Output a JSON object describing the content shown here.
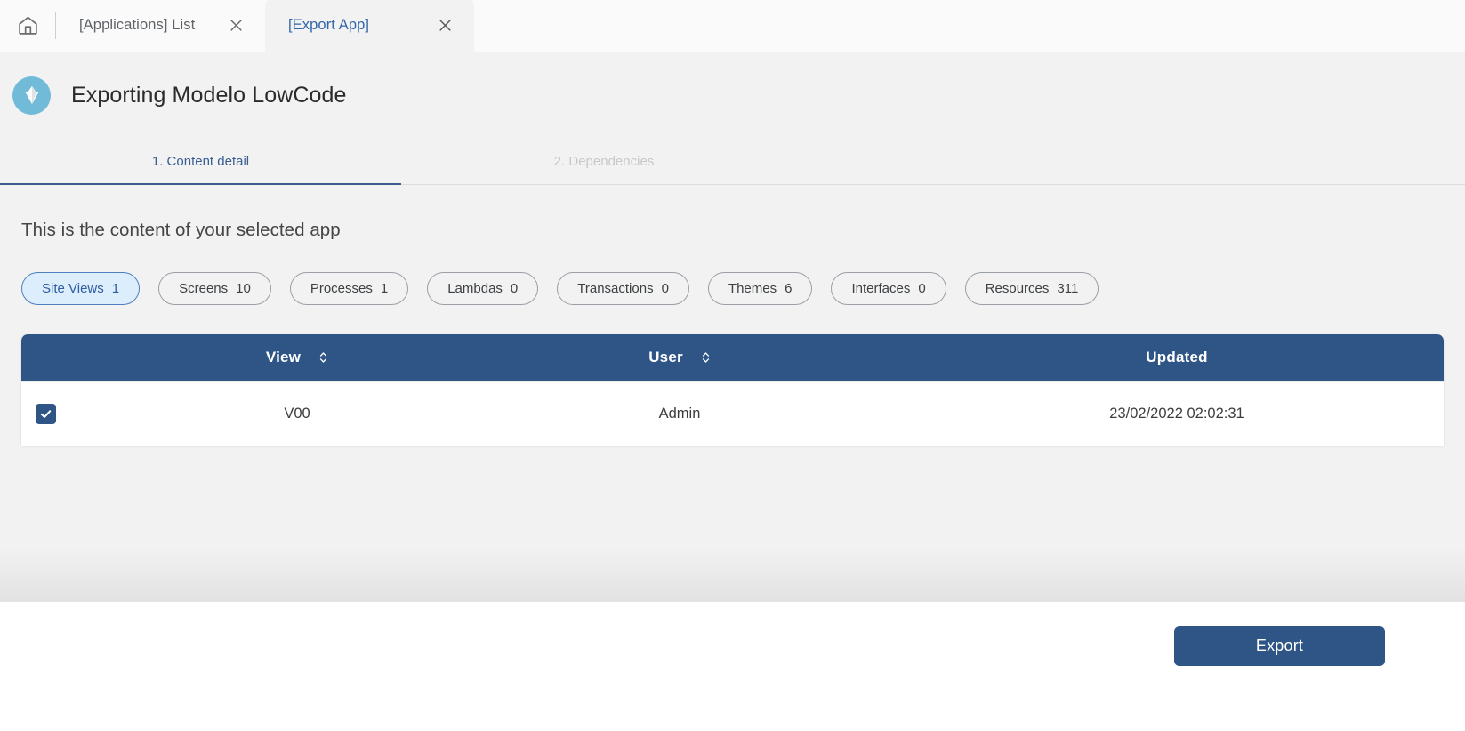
{
  "browser_tabs": {
    "home_icon": "home-icon",
    "tabs": [
      {
        "label": "[Applications] List",
        "active": false,
        "close_icon": "close-icon"
      },
      {
        "label": "[Export App]",
        "active": true,
        "close_icon": "close-icon"
      }
    ]
  },
  "header": {
    "logo_icon": "app-logo-icon",
    "logo_color": "#72bbd8",
    "title": "Exporting Modelo LowCode"
  },
  "steps": [
    {
      "label": "1. Content detail",
      "active": true
    },
    {
      "label": "2. Dependencies",
      "active": false
    }
  ],
  "main": {
    "subtitle": "This is the content of your selected app",
    "chips": [
      {
        "label": "Site Views",
        "count": "1",
        "selected": true
      },
      {
        "label": "Screens",
        "count": "10",
        "selected": false
      },
      {
        "label": "Processes",
        "count": "1",
        "selected": false
      },
      {
        "label": "Lambdas",
        "count": "0",
        "selected": false
      },
      {
        "label": "Transactions",
        "count": "0",
        "selected": false
      },
      {
        "label": "Themes",
        "count": "6",
        "selected": false
      },
      {
        "label": "Interfaces",
        "count": "0",
        "selected": false
      },
      {
        "label": "Resources",
        "count": "311",
        "selected": false
      }
    ],
    "table": {
      "columns": [
        {
          "key": "select",
          "label": "",
          "sortable": false
        },
        {
          "key": "view",
          "label": "View",
          "sortable": true,
          "sort_icon": "sort-icon"
        },
        {
          "key": "user",
          "label": "User",
          "sortable": true,
          "sort_icon": "sort-icon"
        },
        {
          "key": "updated",
          "label": "Updated",
          "sortable": false
        }
      ],
      "rows": [
        {
          "selected": true,
          "view": "V00",
          "user": "Admin",
          "updated": "23/02/2022 02:02:31"
        }
      ]
    }
  },
  "footer": {
    "export_label": "Export"
  },
  "colors": {
    "primary": "#2f5586",
    "brand": "#72bbd8",
    "chip_selected_bg": "#dcedfb",
    "tab_active_text": "#3366a8",
    "page_bg": "#f2f2f2"
  }
}
